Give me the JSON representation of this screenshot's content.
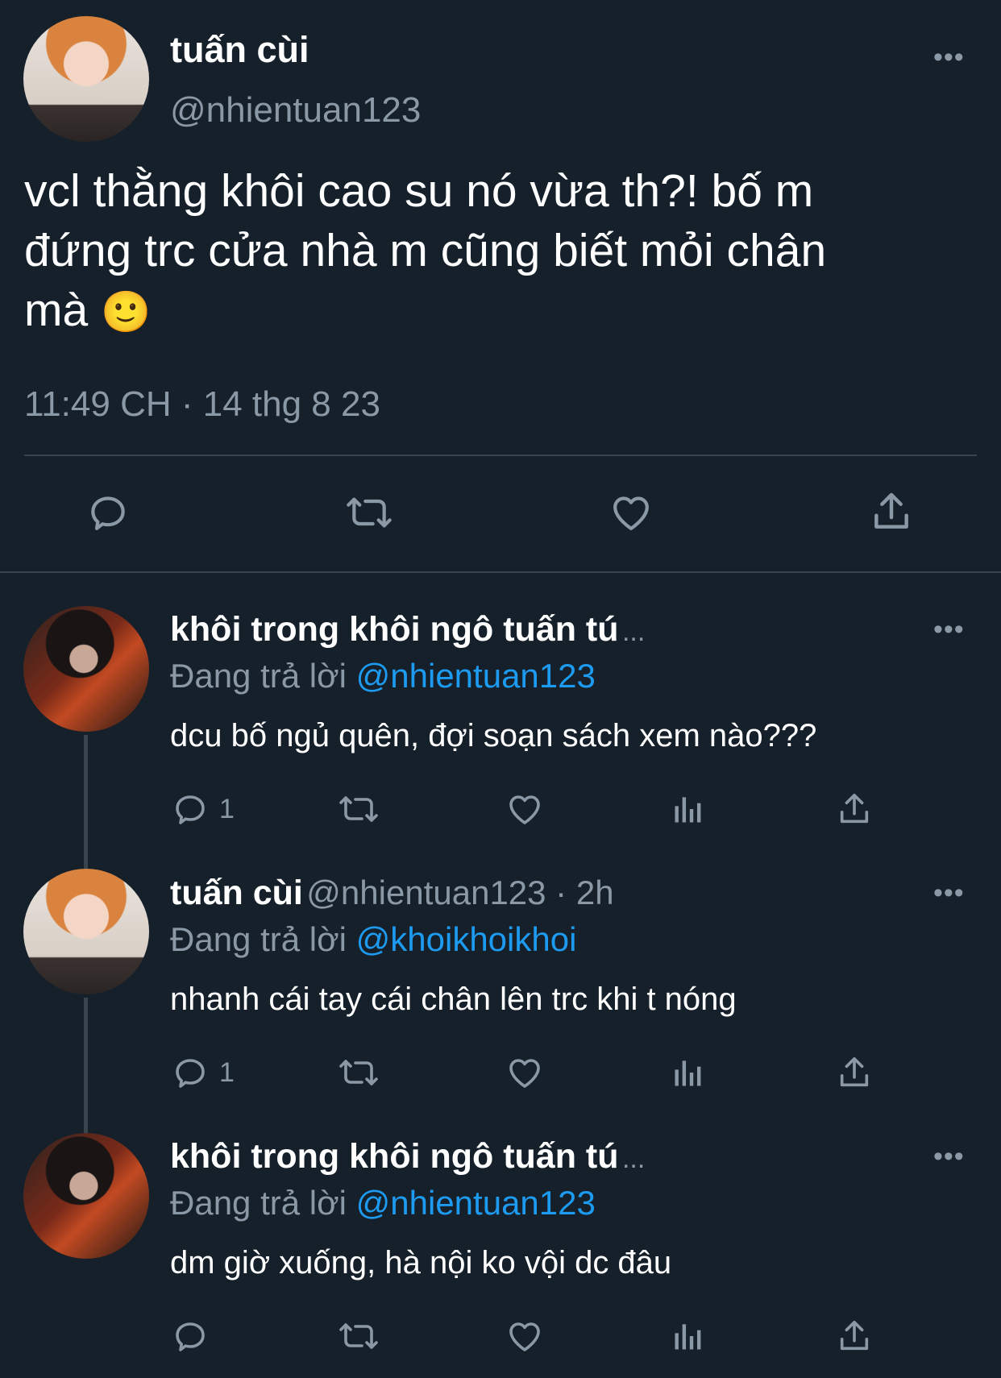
{
  "colors": {
    "background": "#15202b",
    "text": "#ffffff",
    "muted": "#8b98a5",
    "link": "#1d9bf0",
    "divider": "#38444d"
  },
  "main_tweet": {
    "author_name": "tuấn cùi",
    "handle": "@nhientuan123",
    "text_line1": "vcl thằng khôi cao su nó vừa th?! bố m",
    "text_line2": "đứng trc cửa nhà m cũng biết mỏi chân",
    "text_line3": "mà",
    "emoji": "🙂",
    "timestamp": "11:49 CH · 14 thg 8 23",
    "more_label": "•••",
    "actions": [
      "reply-icon",
      "retweet-icon",
      "like-icon",
      "share-icon"
    ]
  },
  "replies": [
    {
      "author_name": "khôi trong khôi ngô tuấn tú",
      "name_suffix": "...",
      "replying_prefix": "Đang trả lời",
      "replying_to": "@nhientuan123",
      "text": "dcu bố ngủ quên, đợi soạn sách xem nào???",
      "reply_count": "1",
      "more_label": "•••"
    },
    {
      "author_name": "tuấn cùi",
      "handle_time": "@nhientuan123 · 2h",
      "replying_prefix": "Đang trả lời",
      "replying_to": "@khoikhoikhoi",
      "text": "nhanh cái tay cái chân lên trc khi t nóng",
      "reply_count": "1",
      "more_label": "•••"
    },
    {
      "author_name": "khôi trong khôi ngô tuấn tú",
      "name_suffix": "...",
      "replying_prefix": "Đang trả lời",
      "replying_to": "@nhientuan123",
      "text": "dm giờ xuống, hà nội ko vội dc đâu",
      "reply_count": "",
      "more_label": "•••"
    }
  ]
}
